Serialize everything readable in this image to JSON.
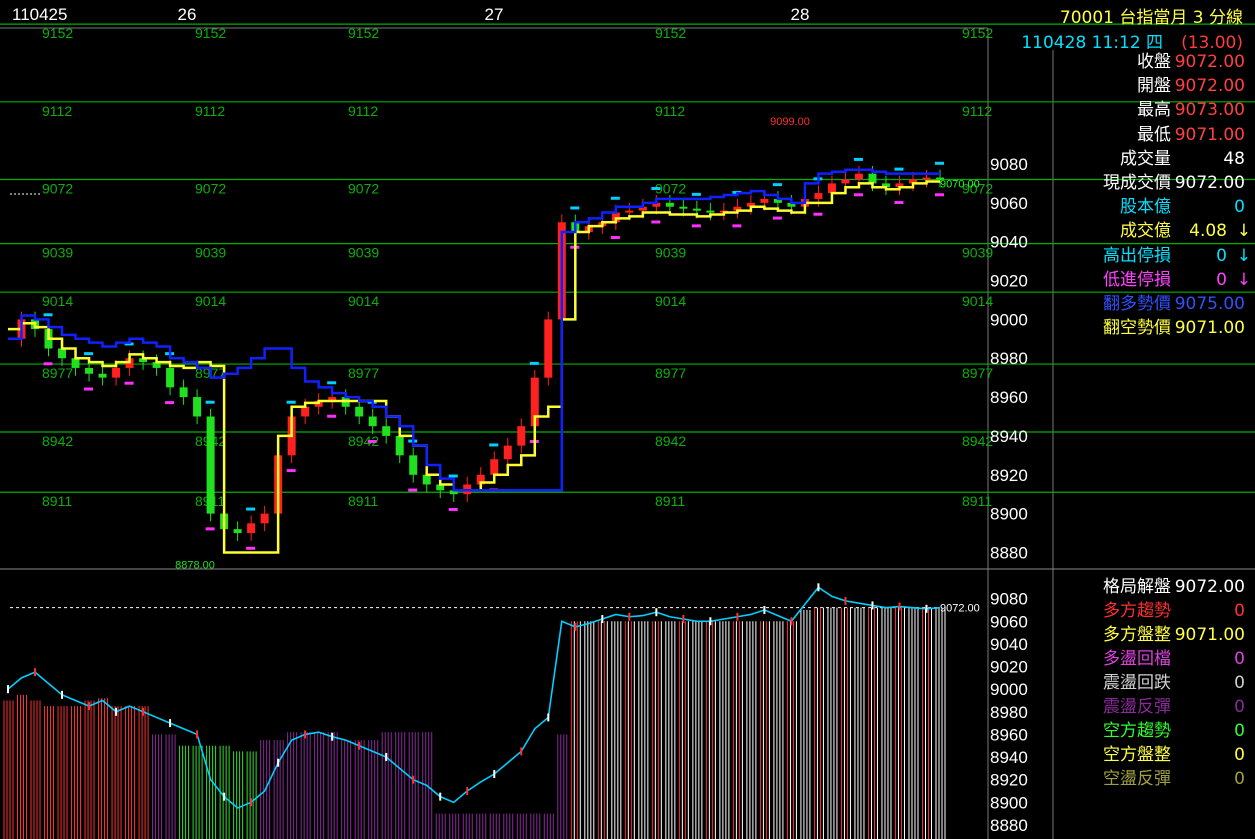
{
  "header": {
    "code_title": "70001  台指當月 3 分線",
    "datetime": "110428 11:12 四",
    "change": "(13.00)"
  },
  "date_labels": {
    "start": "110425",
    "days": [
      "26",
      "27",
      "28"
    ]
  },
  "quote_panel": [
    {
      "label": "收盤",
      "value": "9072.00",
      "label_color": "#ffffff",
      "value_color": "#ff4040"
    },
    {
      "label": "開盤",
      "value": "9072.00",
      "label_color": "#ffffff",
      "value_color": "#ff4040"
    },
    {
      "label": "最高",
      "value": "9073.00",
      "label_color": "#ffffff",
      "value_color": "#ff4040"
    },
    {
      "label": "最低",
      "value": "9071.00",
      "label_color": "#ffffff",
      "value_color": "#ff4040"
    },
    {
      "label": "成交量",
      "value": "48",
      "label_color": "#ffffff",
      "value_color": "#ffffff"
    },
    {
      "label": "現成交價",
      "value": "9072.00",
      "label_color": "#ffffff",
      "value_color": "#ffffff"
    },
    {
      "label": "股本億",
      "value": "0",
      "label_color": "#00e0ff",
      "value_color": "#00e0ff"
    },
    {
      "label": "成交億",
      "value": "4.08",
      "label_color": "#ffff44",
      "value_color": "#ffff44",
      "arrow": "↓",
      "arrow_color": "#ffff44"
    },
    {
      "label": "高出停損",
      "value": "0",
      "label_color": "#00e0ff",
      "value_color": "#00e0ff",
      "arrow": "↓",
      "arrow_color": "#00e0ff"
    },
    {
      "label": "低進停損",
      "value": "0",
      "label_color": "#ff40ff",
      "value_color": "#ff40ff",
      "arrow": "↓",
      "arrow_color": "#ff40ff"
    },
    {
      "label": "翻多勢價",
      "value": "9075.00",
      "label_color": "#3050ff",
      "value_color": "#3050ff"
    },
    {
      "label": "翻空勢價",
      "value": "9071.00",
      "label_color": "#ffff44",
      "value_color": "#ffff44"
    }
  ],
  "status_panel": [
    {
      "label": "格局解盤",
      "value": "9072.00",
      "label_color": "#ffffff",
      "value_color": "#ffffff"
    },
    {
      "label": "多方趨勢",
      "value": "0",
      "label_color": "#ff3030",
      "value_color": "#ff3030"
    },
    {
      "label": "多方盤整",
      "value": "9071.00",
      "label_color": "#ffff44",
      "value_color": "#ffff44"
    },
    {
      "label": "多盪回檔",
      "value": "0",
      "label_color": "#e040e0",
      "value_color": "#e040e0"
    },
    {
      "label": "震盪回跌",
      "value": "0",
      "label_color": "#d0d0d0",
      "value_color": "#d0d0d0"
    },
    {
      "label": "震盪反彈",
      "value": "0",
      "label_color": "#8a2a9a",
      "value_color": "#8a2a9a"
    },
    {
      "label": "空方趨勢",
      "value": "0",
      "label_color": "#30ff30",
      "value_color": "#30ff30"
    },
    {
      "label": "空方盤整",
      "value": "0",
      "label_color": "#ffff44",
      "value_color": "#ffff44"
    },
    {
      "label": "空盪反彈",
      "value": "0",
      "label_color": "#a0a040",
      "value_color": "#a0a040"
    }
  ],
  "chart_data": [
    {
      "type": "line",
      "price_axis_ticks": [
        8880,
        8900,
        8920,
        8940,
        8960,
        8980,
        9000,
        9020,
        9040,
        9060,
        9080
      ],
      "ylim": [
        8872,
        9150
      ],
      "level_lines": [
        9152,
        9112,
        9072,
        9039,
        9014,
        8977,
        8942,
        8911
      ],
      "level_color": "#00b000",
      "marker_high": "9099.00",
      "marker_low": "8878.00",
      "last_price_label": "9070.00",
      "series": [
        {
          "values": [
            8990,
            9000,
            8995,
            8985,
            8980,
            8975,
            8972,
            8970,
            8975,
            8980,
            8978,
            8975,
            8965,
            8960,
            8950,
            8900,
            8892,
            8890,
            8895,
            8900,
            8930,
            8950,
            8955,
            8958,
            8960,
            8955,
            8950,
            8945,
            8940,
            8930,
            8920,
            8915,
            8912,
            8910,
            8915,
            8920,
            8928,
            8935,
            8945,
            8970,
            9000,
            9050,
            9045,
            9048,
            9050,
            9055,
            9056,
            9058,
            9060,
            9058,
            9057,
            9056,
            9055,
            9056,
            9058,
            9060,
            9062,
            9060,
            9058,
            9062,
            9065,
            9070,
            9072,
            9075,
            9070,
            9068,
            9070,
            9072,
            9073,
            9072
          ]
        },
        {
          "values": [
            8995,
            8998,
            8996,
            8990,
            8985,
            8980,
            8978,
            8976,
            8978,
            8982,
            8980,
            8978,
            8976,
            8975,
            8978,
            8976,
            8880,
            8880,
            8880,
            8880,
            8940,
            8955,
            8957,
            8958,
            8958,
            8958,
            8958,
            8958,
            8950,
            8940,
            8935,
            8920,
            8915,
            8912,
            8912,
            8916,
            8920,
            8925,
            8930,
            8950,
            8955,
            9000,
            9045,
            9048,
            9050,
            9052,
            9053,
            9055,
            9055,
            9054,
            9054,
            9053,
            9054,
            9055,
            9056,
            9058,
            9057,
            9056,
            9055,
            9060,
            9060,
            9065,
            9068,
            9070,
            9068,
            9067,
            9068,
            9070,
            9071,
            9071
          ]
        },
        {
          "values": [
            8990,
            9002,
            9000,
            8996,
            8992,
            8990,
            8988,
            8986,
            8988,
            8990,
            8988,
            8986,
            8980,
            8978,
            8975,
            8970,
            8972,
            8975,
            8980,
            8985,
            8985,
            8975,
            8968,
            8965,
            8962,
            8960,
            8958,
            8955,
            8950,
            8945,
            8935,
            8925,
            8918,
            8912,
            8912,
            8912,
            8912,
            8912,
            8912,
            8912,
            8912,
            9045,
            9050,
            9052,
            9055,
            9058,
            9058,
            9060,
            9062,
            9062,
            9062,
            9062,
            9063,
            9064,
            9065,
            9066,
            9064,
            9062,
            9060,
            9070,
            9075,
            9076,
            9077,
            9077,
            9076,
            9075,
            9075,
            9075,
            9075,
            9075
          ]
        }
      ]
    },
    {
      "type": "bar",
      "price_axis_ticks": [
        8880,
        8900,
        8920,
        8940,
        8960,
        8980,
        9000,
        9020,
        9040,
        9060,
        9080
      ],
      "ylim": [
        8872,
        9100
      ],
      "last_price_label": "9072.00",
      "series": [
        {
          "values": [
            9000,
            9010,
            9015,
            9005,
            8995,
            8990,
            8985,
            8990,
            8980,
            8985,
            8980,
            8975,
            8970,
            8965,
            8960,
            8920,
            8905,
            8895,
            8900,
            8910,
            8935,
            8955,
            8960,
            8962,
            8958,
            8955,
            8950,
            8945,
            8940,
            8930,
            8920,
            8915,
            8905,
            8900,
            8910,
            8918,
            8925,
            8935,
            8945,
            8965,
            8975,
            9060,
            9055,
            9058,
            9062,
            9066,
            9064,
            9065,
            9068,
            9064,
            9062,
            9060,
            9060,
            9062,
            9064,
            9066,
            9070,
            9065,
            9060,
            9075,
            9090,
            9082,
            9078,
            9076,
            9074,
            9072,
            9073,
            9072,
            9071,
            9072
          ]
        },
        {
          "values": [
            8990,
            8995,
            8990,
            8985,
            8985,
            8985,
            8990,
            8992,
            8985,
            8985,
            8985,
            8960,
            8960,
            8950,
            8950,
            8950,
            8950,
            8945,
            8945,
            8955,
            8955,
            8962,
            8962,
            8962,
            8962,
            8955,
            8955,
            8955,
            8962,
            8962,
            8962,
            8962,
            8890,
            8890,
            8890,
            8890,
            8890,
            8890,
            8890,
            8890,
            8890,
            8960,
            9060,
            9060,
            9060,
            9060,
            9060,
            9060,
            9060,
            9060,
            9060,
            9060,
            9060,
            9060,
            9060,
            9060,
            9060,
            9060,
            9060,
            9070,
            9072,
            9072,
            9072,
            9072,
            9072,
            9072,
            9072,
            9072,
            9072,
            9072
          ]
        }
      ]
    }
  ]
}
